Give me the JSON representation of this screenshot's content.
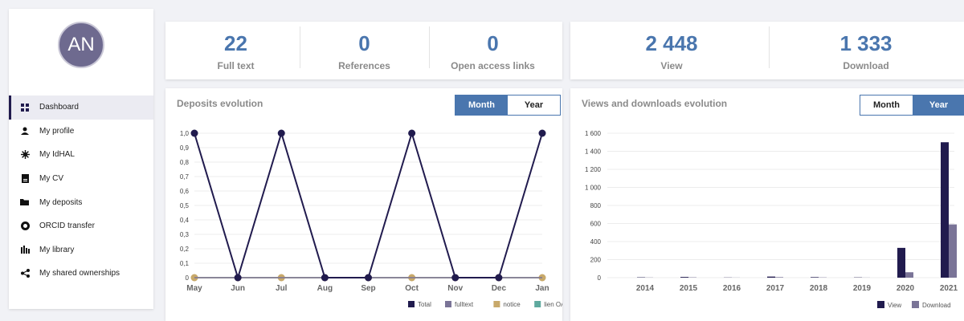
{
  "user": {
    "initials": "AN"
  },
  "sidebar": {
    "items": [
      {
        "label": "Dashboard",
        "icon": "dashboard-icon",
        "active": true
      },
      {
        "label": "My profile",
        "icon": "user-icon"
      },
      {
        "label": "My IdHAL",
        "icon": "idhal-icon"
      },
      {
        "label": "My CV",
        "icon": "cv-icon"
      },
      {
        "label": "My deposits",
        "icon": "folder-icon"
      },
      {
        "label": "ORCID transfer",
        "icon": "orcid-icon"
      },
      {
        "label": "My library",
        "icon": "library-icon"
      },
      {
        "label": "My shared ownerships",
        "icon": "share-icon"
      }
    ]
  },
  "stats_left": [
    {
      "value": "22",
      "label": "Full text"
    },
    {
      "value": "0",
      "label": "References"
    },
    {
      "value": "0",
      "label": "Open access links"
    }
  ],
  "stats_right": [
    {
      "value": "2 448",
      "label": "View"
    },
    {
      "value": "1 333",
      "label": "Download"
    }
  ],
  "deposits": {
    "title": "Deposits evolution",
    "toggle": {
      "month": "Month",
      "year": "Year",
      "active": "month"
    }
  },
  "views": {
    "title": "Views and downloads evolution",
    "toggle": {
      "month": "Month",
      "year": "Year",
      "active": "year"
    }
  },
  "colors": {
    "accent": "#4a76ae",
    "total": "#211b4e",
    "fulltext": "#7a7497",
    "notice": "#c8a96a",
    "lienoa": "#5ea99e",
    "view": "#211b4e",
    "download": "#7a7497"
  },
  "chart_data": [
    {
      "type": "line",
      "title": "Deposits evolution",
      "categories": [
        "May",
        "Jun",
        "Jul",
        "Aug",
        "Sep",
        "Oct",
        "Nov",
        "Dec",
        "Jan"
      ],
      "ylim": [
        0,
        1
      ],
      "yticks": [
        "0",
        "0,1",
        "0,2",
        "0,3",
        "0,4",
        "0,5",
        "0,6",
        "0,7",
        "0,8",
        "0,9",
        "1,0"
      ],
      "series": [
        {
          "name": "Total",
          "values": [
            1,
            0,
            1,
            0,
            0,
            1,
            0,
            0,
            1
          ]
        },
        {
          "name": "fulltext",
          "values": [
            0,
            0,
            0,
            0,
            0,
            0,
            0,
            0,
            0
          ]
        },
        {
          "name": "notice",
          "values": [
            0,
            0,
            0,
            0,
            0,
            0,
            0,
            0,
            0
          ]
        },
        {
          "name": "lien OA",
          "values": [
            0,
            0,
            0,
            0,
            0,
            0,
            0,
            0,
            0
          ]
        }
      ],
      "legend": "bottom-right",
      "grid": true
    },
    {
      "type": "bar",
      "title": "Views and downloads evolution",
      "categories": [
        "2014",
        "2015",
        "2016",
        "2017",
        "2018",
        "2019",
        "2020",
        "2021"
      ],
      "ylim": [
        0,
        1600
      ],
      "yticks": [
        "0",
        "200",
        "400",
        "600",
        "800",
        "1 000",
        "1 200",
        "1 400",
        "1 600"
      ],
      "series": [
        {
          "name": "View",
          "values": [
            4,
            8,
            2,
            12,
            6,
            3,
            330,
            1500
          ]
        },
        {
          "name": "Download",
          "values": [
            2,
            4,
            1,
            6,
            3,
            1,
            60,
            590
          ]
        }
      ],
      "legend": "bottom-right",
      "grid": true
    }
  ]
}
